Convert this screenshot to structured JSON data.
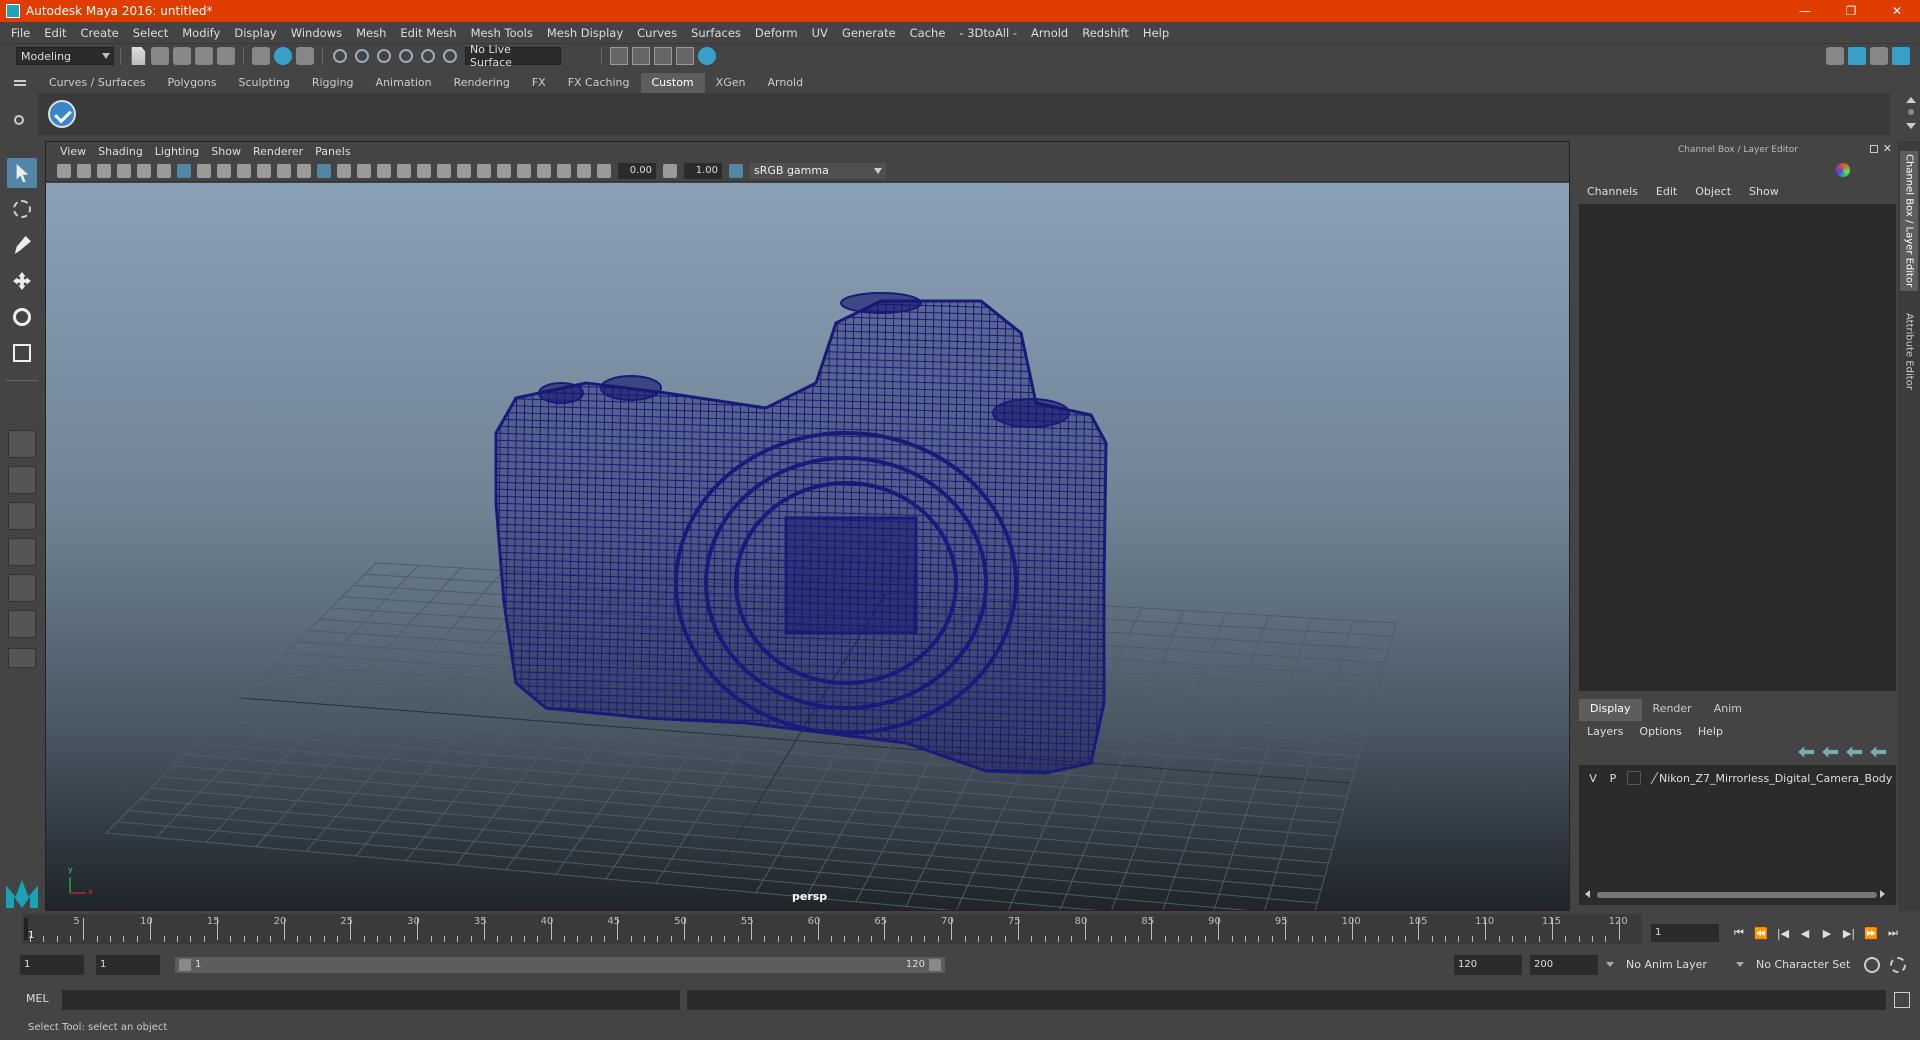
{
  "window": {
    "title": "Autodesk Maya 2016: untitled*",
    "buttons": [
      "—",
      "❐",
      "✕"
    ]
  },
  "menubar": [
    "File",
    "Edit",
    "Create",
    "Select",
    "Modify",
    "Display",
    "Windows",
    "Mesh",
    "Edit Mesh",
    "Mesh Tools",
    "Mesh Display",
    "Curves",
    "Surfaces",
    "Deform",
    "UV",
    "Generate",
    "Cache",
    "- 3DtoAll -",
    "Arnold",
    "Redshift",
    "Help"
  ],
  "statusline": {
    "mode": "Modeling",
    "live_surface": "No Live Surface"
  },
  "shelf": {
    "tabs": [
      "Curves / Surfaces",
      "Polygons",
      "Sculpting",
      "Rigging",
      "Animation",
      "Rendering",
      "FX",
      "FX Caching",
      "Custom",
      "XGen",
      "Arnold"
    ],
    "active_tab": "Custom"
  },
  "viewport": {
    "menu": [
      "View",
      "Shading",
      "Lighting",
      "Show",
      "Renderer",
      "Panels"
    ],
    "exposure": "0.00",
    "gamma": "1.00",
    "color_space": "sRGB gamma",
    "camera_label": "persp",
    "axis_y": "y",
    "axis_x": "x",
    "wire_color": "#1a1a7a"
  },
  "channel_box": {
    "header": "Channel Box / Layer Editor",
    "menu": [
      "Channels",
      "Edit",
      "Object",
      "Show"
    ]
  },
  "layer_editor": {
    "tabs": [
      "Display",
      "Render",
      "Anim"
    ],
    "active_tab": "Display",
    "menu": [
      "Layers",
      "Options",
      "Help"
    ],
    "layers": [
      {
        "v": "V",
        "p": "P",
        "name": "Nikon_Z7_Mirrorless_Digital_Camera_Body"
      }
    ]
  },
  "side_tabs": [
    "Channel Box / Layer Editor",
    "Attribute Editor"
  ],
  "timeline": {
    "ticks": [
      "5",
      "10",
      "15",
      "20",
      "25",
      "30",
      "35",
      "40",
      "45",
      "50",
      "55",
      "60",
      "65",
      "70",
      "75",
      "80",
      "85",
      "90",
      "95",
      "100",
      "105",
      "110",
      "115",
      "120"
    ],
    "current_frame_marker": "1",
    "current_frame": "1"
  },
  "range": {
    "start": "1",
    "playback_start": "1",
    "slider_low": "1",
    "slider_high": "120",
    "playback_end": "120",
    "end": "200",
    "anim_layer": "No Anim Layer",
    "character_set": "No Character Set"
  },
  "command_line": {
    "label": "MEL"
  },
  "help_line": "Select Tool: select an object"
}
